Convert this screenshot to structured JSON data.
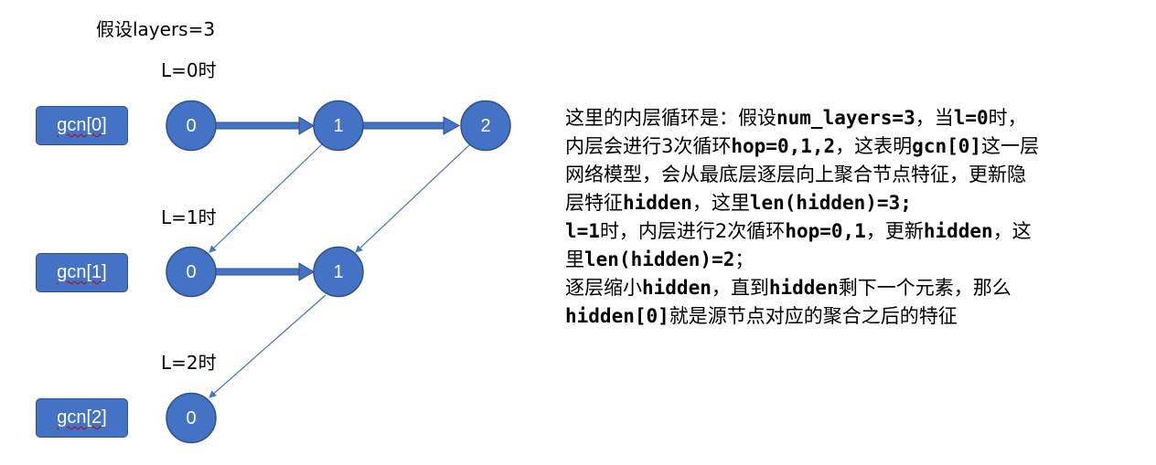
{
  "title": "假设layers=3",
  "levels": [
    {
      "label": "L=0时",
      "box": "gcn[0]",
      "nodes": [
        "0",
        "1",
        "2"
      ]
    },
    {
      "label": "L=1时",
      "box": "gcn[1]",
      "nodes": [
        "0",
        "1"
      ]
    },
    {
      "label": "L=2时",
      "box": "gcn[2]",
      "nodes": [
        "0"
      ]
    }
  ],
  "explanation": [
    [
      {
        "t": "这里的内层循环是：假设"
      },
      {
        "t": "num_layers=3",
        "mono": true
      },
      {
        "t": "，当"
      },
      {
        "t": "l=0",
        "mono": true
      },
      {
        "t": "时，"
      }
    ],
    [
      {
        "t": "内层会进行3次循环"
      },
      {
        "t": "hop=0,1,2",
        "mono": true
      },
      {
        "t": "，这表明"
      },
      {
        "t": "gcn[0]",
        "mono": true
      },
      {
        "t": "这一层"
      }
    ],
    [
      {
        "t": "网络模型，会从最底层逐层向上聚合节点特征，更新隐"
      }
    ],
    [
      {
        "t": "层特征"
      },
      {
        "t": "hidden",
        "mono": true
      },
      {
        "t": "，这里"
      },
      {
        "t": "len(hidden)=3;",
        "mono": true
      }
    ],
    [
      {
        "t": "l=1",
        "mono": true
      },
      {
        "t": "时，内层进行2次循环"
      },
      {
        "t": "hop=0,1",
        "mono": true
      },
      {
        "t": "，更新"
      },
      {
        "t": "hidden",
        "mono": true
      },
      {
        "t": "，这"
      }
    ],
    [
      {
        "t": "里"
      },
      {
        "t": "len(hidden)=2",
        "mono": true
      },
      {
        "t": "；"
      }
    ],
    [
      {
        "t": "逐层缩小"
      },
      {
        "t": "hidden",
        "mono": true
      },
      {
        "t": "，直到"
      },
      {
        "t": "hidden",
        "mono": true
      },
      {
        "t": "剩下一个元素，那么"
      }
    ],
    [
      {
        "t": "hidden[0]",
        "mono": true
      },
      {
        "t": "就是源节点对应的聚合之后的特征"
      }
    ]
  ],
  "colors": {
    "node_fill": "#4472c4",
    "node_stroke": "#2f528f",
    "arrow": "#4472c4",
    "box_fill": "#4472c4"
  }
}
